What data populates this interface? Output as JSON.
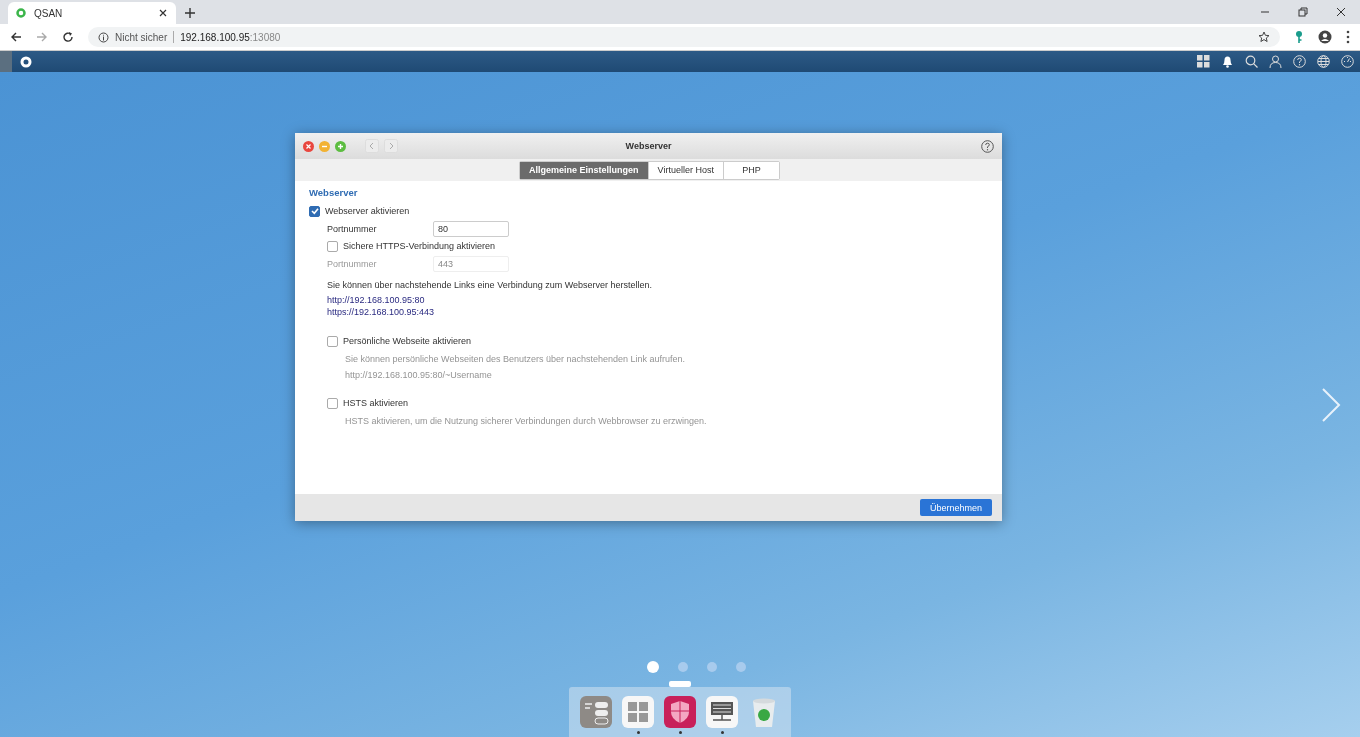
{
  "browser": {
    "tab_title": "QSAN",
    "security": "Nicht sicher",
    "host": "192.168.100.95",
    "port": ":13080"
  },
  "dialog": {
    "title": "Webserver",
    "tabs": [
      {
        "label": "Allgemeine Einstellungen",
        "selected": true
      },
      {
        "label": "Virtueller Host",
        "selected": false
      },
      {
        "label": "PHP",
        "selected": false
      }
    ],
    "section": "Webserver",
    "enable": {
      "label": "Webserver aktivieren",
      "checked": true
    },
    "http_port": {
      "label": "Portnummer",
      "value": "80"
    },
    "https": {
      "label": "Sichere HTTPS-Verbindung aktivieren",
      "checked": false
    },
    "https_port": {
      "label": "Portnummer",
      "value": "443",
      "disabled": true
    },
    "info": "Sie können über nachstehende Links eine Verbindung zum Webserver herstellen.",
    "links": [
      "http://192.168.100.95:80",
      "https://192.168.100.95:443"
    ],
    "personal": {
      "label": "Persönliche Webseite aktivieren",
      "checked": false,
      "description": [
        "Sie können persönliche Webseiten des Benutzers über nachstehenden Link aufrufen.",
        "http://192.168.100.95:80/~Username"
      ]
    },
    "hsts": {
      "label": "HSTS aktivieren",
      "checked": false,
      "description": [
        "HSTS aktivieren, um die Nutzung sicherer Verbindungen durch Webbrowser zu erzwingen."
      ]
    },
    "apply": "Übernehmen"
  },
  "pages": [
    {
      "selected": true
    },
    {
      "selected": false
    },
    {
      "selected": false
    },
    {
      "selected": false
    }
  ],
  "dock": [
    {
      "kind": "switches",
      "running": false,
      "selected": false
    },
    {
      "kind": "grid",
      "running": true,
      "selected": false
    },
    {
      "kind": "shield",
      "running": true,
      "selected": true
    },
    {
      "kind": "server",
      "running": true,
      "selected": false
    },
    {
      "kind": "trash",
      "running": false,
      "selected": false
    }
  ]
}
